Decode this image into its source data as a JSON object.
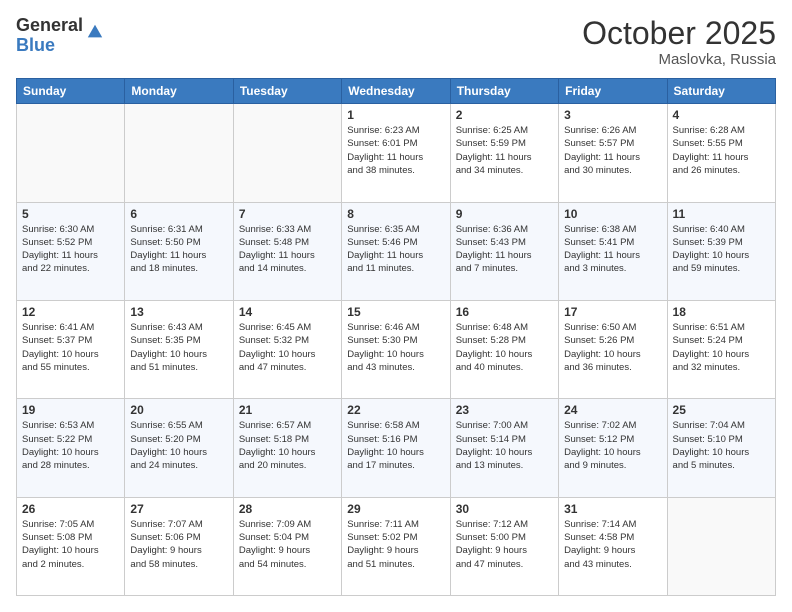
{
  "header": {
    "logo_general": "General",
    "logo_blue": "Blue",
    "month_title": "October 2025",
    "location": "Maslovka, Russia"
  },
  "days_of_week": [
    "Sunday",
    "Monday",
    "Tuesday",
    "Wednesday",
    "Thursday",
    "Friday",
    "Saturday"
  ],
  "weeks": [
    [
      {
        "day": "",
        "info": ""
      },
      {
        "day": "",
        "info": ""
      },
      {
        "day": "",
        "info": ""
      },
      {
        "day": "1",
        "info": "Sunrise: 6:23 AM\nSunset: 6:01 PM\nDaylight: 11 hours\nand 38 minutes."
      },
      {
        "day": "2",
        "info": "Sunrise: 6:25 AM\nSunset: 5:59 PM\nDaylight: 11 hours\nand 34 minutes."
      },
      {
        "day": "3",
        "info": "Sunrise: 6:26 AM\nSunset: 5:57 PM\nDaylight: 11 hours\nand 30 minutes."
      },
      {
        "day": "4",
        "info": "Sunrise: 6:28 AM\nSunset: 5:55 PM\nDaylight: 11 hours\nand 26 minutes."
      }
    ],
    [
      {
        "day": "5",
        "info": "Sunrise: 6:30 AM\nSunset: 5:52 PM\nDaylight: 11 hours\nand 22 minutes."
      },
      {
        "day": "6",
        "info": "Sunrise: 6:31 AM\nSunset: 5:50 PM\nDaylight: 11 hours\nand 18 minutes."
      },
      {
        "day": "7",
        "info": "Sunrise: 6:33 AM\nSunset: 5:48 PM\nDaylight: 11 hours\nand 14 minutes."
      },
      {
        "day": "8",
        "info": "Sunrise: 6:35 AM\nSunset: 5:46 PM\nDaylight: 11 hours\nand 11 minutes."
      },
      {
        "day": "9",
        "info": "Sunrise: 6:36 AM\nSunset: 5:43 PM\nDaylight: 11 hours\nand 7 minutes."
      },
      {
        "day": "10",
        "info": "Sunrise: 6:38 AM\nSunset: 5:41 PM\nDaylight: 11 hours\nand 3 minutes."
      },
      {
        "day": "11",
        "info": "Sunrise: 6:40 AM\nSunset: 5:39 PM\nDaylight: 10 hours\nand 59 minutes."
      }
    ],
    [
      {
        "day": "12",
        "info": "Sunrise: 6:41 AM\nSunset: 5:37 PM\nDaylight: 10 hours\nand 55 minutes."
      },
      {
        "day": "13",
        "info": "Sunrise: 6:43 AM\nSunset: 5:35 PM\nDaylight: 10 hours\nand 51 minutes."
      },
      {
        "day": "14",
        "info": "Sunrise: 6:45 AM\nSunset: 5:32 PM\nDaylight: 10 hours\nand 47 minutes."
      },
      {
        "day": "15",
        "info": "Sunrise: 6:46 AM\nSunset: 5:30 PM\nDaylight: 10 hours\nand 43 minutes."
      },
      {
        "day": "16",
        "info": "Sunrise: 6:48 AM\nSunset: 5:28 PM\nDaylight: 10 hours\nand 40 minutes."
      },
      {
        "day": "17",
        "info": "Sunrise: 6:50 AM\nSunset: 5:26 PM\nDaylight: 10 hours\nand 36 minutes."
      },
      {
        "day": "18",
        "info": "Sunrise: 6:51 AM\nSunset: 5:24 PM\nDaylight: 10 hours\nand 32 minutes."
      }
    ],
    [
      {
        "day": "19",
        "info": "Sunrise: 6:53 AM\nSunset: 5:22 PM\nDaylight: 10 hours\nand 28 minutes."
      },
      {
        "day": "20",
        "info": "Sunrise: 6:55 AM\nSunset: 5:20 PM\nDaylight: 10 hours\nand 24 minutes."
      },
      {
        "day": "21",
        "info": "Sunrise: 6:57 AM\nSunset: 5:18 PM\nDaylight: 10 hours\nand 20 minutes."
      },
      {
        "day": "22",
        "info": "Sunrise: 6:58 AM\nSunset: 5:16 PM\nDaylight: 10 hours\nand 17 minutes."
      },
      {
        "day": "23",
        "info": "Sunrise: 7:00 AM\nSunset: 5:14 PM\nDaylight: 10 hours\nand 13 minutes."
      },
      {
        "day": "24",
        "info": "Sunrise: 7:02 AM\nSunset: 5:12 PM\nDaylight: 10 hours\nand 9 minutes."
      },
      {
        "day": "25",
        "info": "Sunrise: 7:04 AM\nSunset: 5:10 PM\nDaylight: 10 hours\nand 5 minutes."
      }
    ],
    [
      {
        "day": "26",
        "info": "Sunrise: 7:05 AM\nSunset: 5:08 PM\nDaylight: 10 hours\nand 2 minutes."
      },
      {
        "day": "27",
        "info": "Sunrise: 7:07 AM\nSunset: 5:06 PM\nDaylight: 9 hours\nand 58 minutes."
      },
      {
        "day": "28",
        "info": "Sunrise: 7:09 AM\nSunset: 5:04 PM\nDaylight: 9 hours\nand 54 minutes."
      },
      {
        "day": "29",
        "info": "Sunrise: 7:11 AM\nSunset: 5:02 PM\nDaylight: 9 hours\nand 51 minutes."
      },
      {
        "day": "30",
        "info": "Sunrise: 7:12 AM\nSunset: 5:00 PM\nDaylight: 9 hours\nand 47 minutes."
      },
      {
        "day": "31",
        "info": "Sunrise: 7:14 AM\nSunset: 4:58 PM\nDaylight: 9 hours\nand 43 minutes."
      },
      {
        "day": "",
        "info": ""
      }
    ]
  ]
}
